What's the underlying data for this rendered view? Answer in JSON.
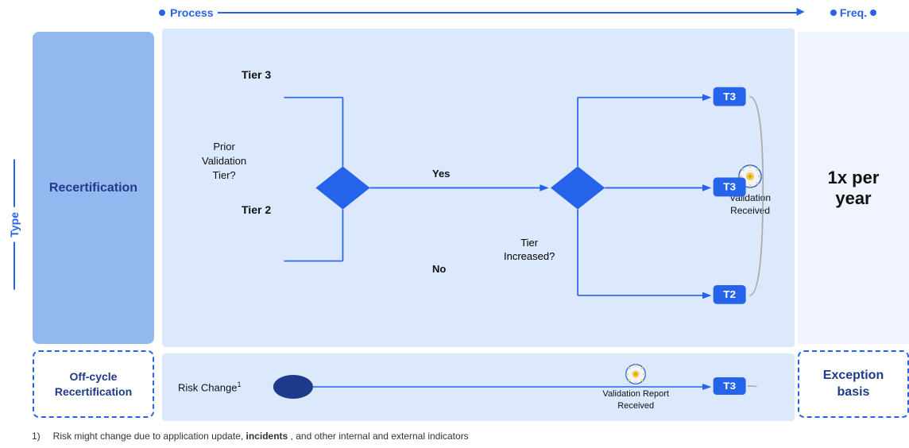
{
  "header": {
    "process_label": "Process",
    "freq_label": "Freq.",
    "type_label": "Type"
  },
  "sidebar": {
    "recertification_label": "Recertification",
    "offcycle_label": "Off-cycle\nRecertification"
  },
  "diagram": {
    "tier3_label": "Tier 3",
    "tier2_label": "Tier 2",
    "prior_validation_label": "Prior\nValidation\nTier?",
    "yes_label": "Yes",
    "no_label": "No",
    "tier_increased_label": "Tier\nIncreased?",
    "t3_badge": "T3",
    "t2_badge": "T2",
    "validation_received_label": "Validation\nReceived",
    "risk_change_label": "Risk Change",
    "risk_change_superscript": "1",
    "validation_report_label": "Validation Report\nReceived"
  },
  "freq": {
    "main_value": "1x per\nyear",
    "exception_label": "Exception\nbasis"
  },
  "footer": {
    "footnote_number": "1)",
    "footnote_text": "Risk might change due to application update,",
    "footnote_bold": "incidents",
    "footnote_end": ", and other internal and external indicators"
  }
}
